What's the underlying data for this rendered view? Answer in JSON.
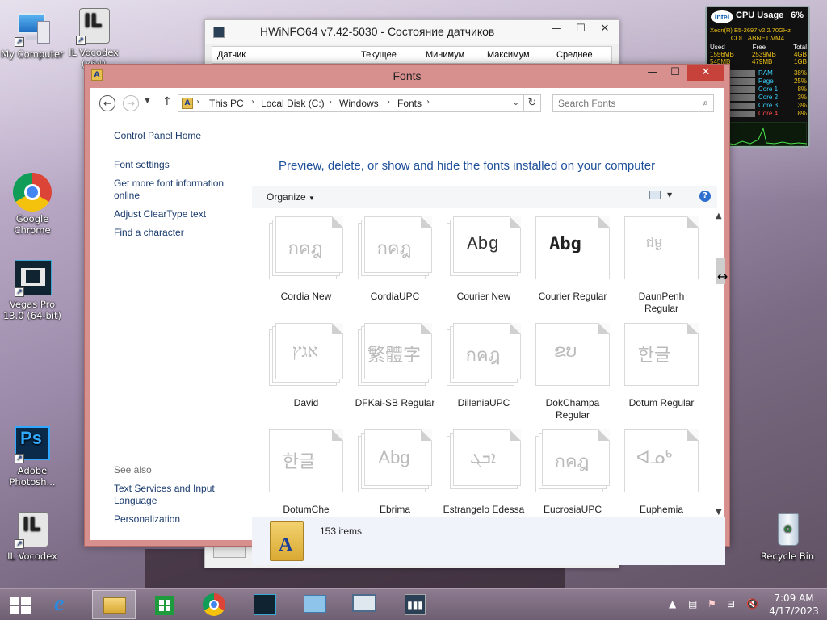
{
  "desktop": {
    "icons": [
      {
        "label": "My Computer",
        "icon": "computer-icon"
      },
      {
        "label": "IL Vocodex (x64)",
        "icon": "il-vocodex-icon"
      },
      {
        "label": "Google Chrome",
        "icon": "chrome-icon"
      },
      {
        "label": "Vegas Pro 13.0 (64-bit)",
        "icon": "vegas-icon"
      },
      {
        "label": "Adobe Photosh...",
        "icon": "photoshop-icon"
      },
      {
        "label": "IL Vocodex",
        "icon": "il-vocodex-icon"
      },
      {
        "label": "Recycle Bin",
        "icon": "recycle-bin-icon"
      }
    ]
  },
  "hwinfo": {
    "title": "HWiNFO64 v7.42-5030 - Состояние датчиков",
    "columns": [
      "Датчик",
      "Текущее",
      "Минимум",
      "Максимум",
      "Среднее"
    ]
  },
  "gadget": {
    "title": "CPU Usage",
    "percent": "6%",
    "cpu": "Xeon(R) E5-2697 v2 2.70GHz",
    "host": "COLLABNET\\VM4",
    "mem_headers": [
      "Used",
      "Free",
      "Total"
    ],
    "mem_row1": [
      "1556MB",
      "2539MB",
      "4GB"
    ],
    "mem_row2": [
      "545MB",
      "479MB",
      "1GB"
    ],
    "stats": [
      {
        "label": "RAM",
        "value": "38%"
      },
      {
        "label": "Page",
        "value": "25%"
      },
      {
        "label": "Core 1",
        "value": "8%"
      },
      {
        "label": "Core 2",
        "value": "3%"
      },
      {
        "label": "Core 3",
        "value": "3%"
      },
      {
        "label": "Core 4",
        "value": "8%"
      }
    ]
  },
  "fonts_window": {
    "title": "Fonts",
    "breadcrumb": [
      "This PC",
      "Local Disk (C:)",
      "Windows",
      "Fonts"
    ],
    "search_placeholder": "Search Fonts",
    "sidebar": {
      "control_panel_home": "Control Panel Home",
      "links": [
        "Font settings",
        "Get more font information online",
        "Adjust ClearType text",
        "Find a character"
      ],
      "see_also": "See also",
      "see_also_links": [
        "Text Services and Input Language",
        "Personalization"
      ]
    },
    "heading": "Preview, delete, or show and hide the fonts installed on your computer",
    "toolbar": {
      "organize": "Organize"
    },
    "fonts": [
      {
        "name": "Cordia New",
        "sample": "กคฎ"
      },
      {
        "name": "CordiaUPC",
        "sample": "กคฎ"
      },
      {
        "name": "Courier New",
        "sample": "Abg"
      },
      {
        "name": "Courier Regular",
        "sample": "Abg"
      },
      {
        "name": "DaunPenh Regular",
        "sample": "ជម្ង"
      },
      {
        "name": "David",
        "sample": "אגץ"
      },
      {
        "name": "DFKai-SB Regular",
        "sample": "繁體字"
      },
      {
        "name": "DilleniaUPC",
        "sample": "กคฎ"
      },
      {
        "name": "DokChampa Regular",
        "sample": "ຂບ"
      },
      {
        "name": "Dotum Regular",
        "sample": "한글"
      },
      {
        "name": "DotumChe",
        "sample": "한글"
      },
      {
        "name": "Ebrima",
        "sample": "Abg"
      },
      {
        "name": "Estrangelo Edessa",
        "sample": "ܐܒܓ"
      },
      {
        "name": "EucrosiaUPC",
        "sample": "กคฎ"
      },
      {
        "name": "Euphemia",
        "sample": "ᐊᓄᒃ"
      }
    ],
    "status": "153 items"
  },
  "taskbar": {
    "time": "7:09 AM",
    "date": "4/17/2023"
  }
}
